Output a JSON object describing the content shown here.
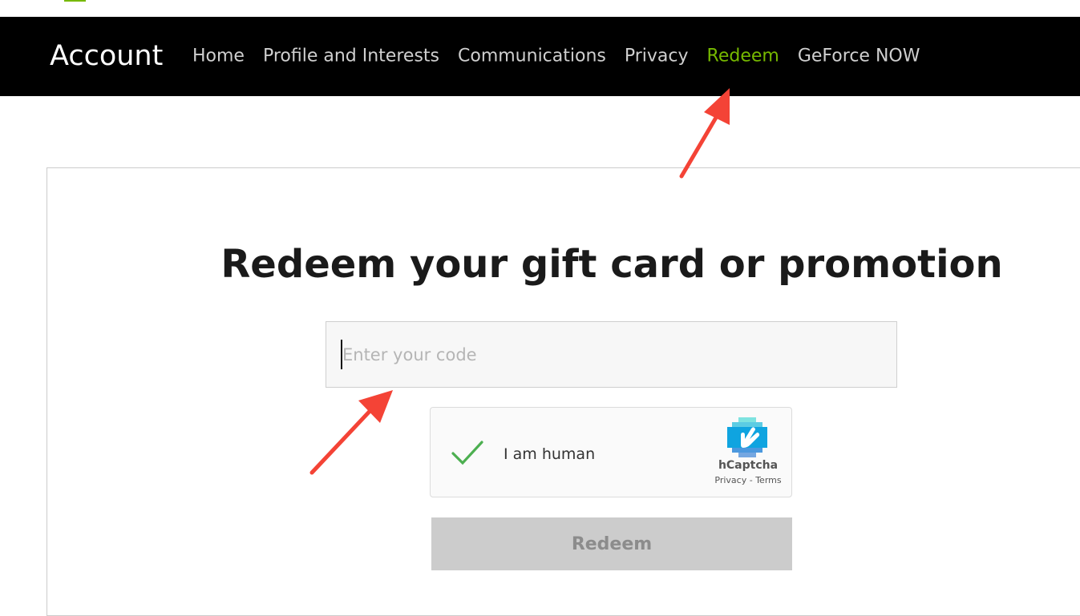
{
  "header": {
    "brand": "Account",
    "nav": [
      {
        "label": "Home",
        "active": false
      },
      {
        "label": "Profile and Interests",
        "active": false
      },
      {
        "label": "Communications",
        "active": false
      },
      {
        "label": "Privacy",
        "active": false
      },
      {
        "label": "Redeem",
        "active": true
      },
      {
        "label": "GeForce NOW",
        "active": false
      }
    ]
  },
  "main": {
    "title": "Redeem your gift card or promotion",
    "code_input": {
      "placeholder": "Enter your code",
      "value": ""
    },
    "captcha": {
      "label": "I am human",
      "provider": "hCaptcha",
      "links": "Privacy - Terms",
      "checked": true
    },
    "redeem_button": {
      "label": "Redeem",
      "enabled": false
    }
  },
  "colors": {
    "accent": "#76b900",
    "topbar_bg": "#000000",
    "annotation_arrow": "#f44336",
    "check": "#4caf50"
  },
  "icons": [
    "check-icon",
    "hcaptcha-logo-icon",
    "annotation-arrow-icon"
  ]
}
